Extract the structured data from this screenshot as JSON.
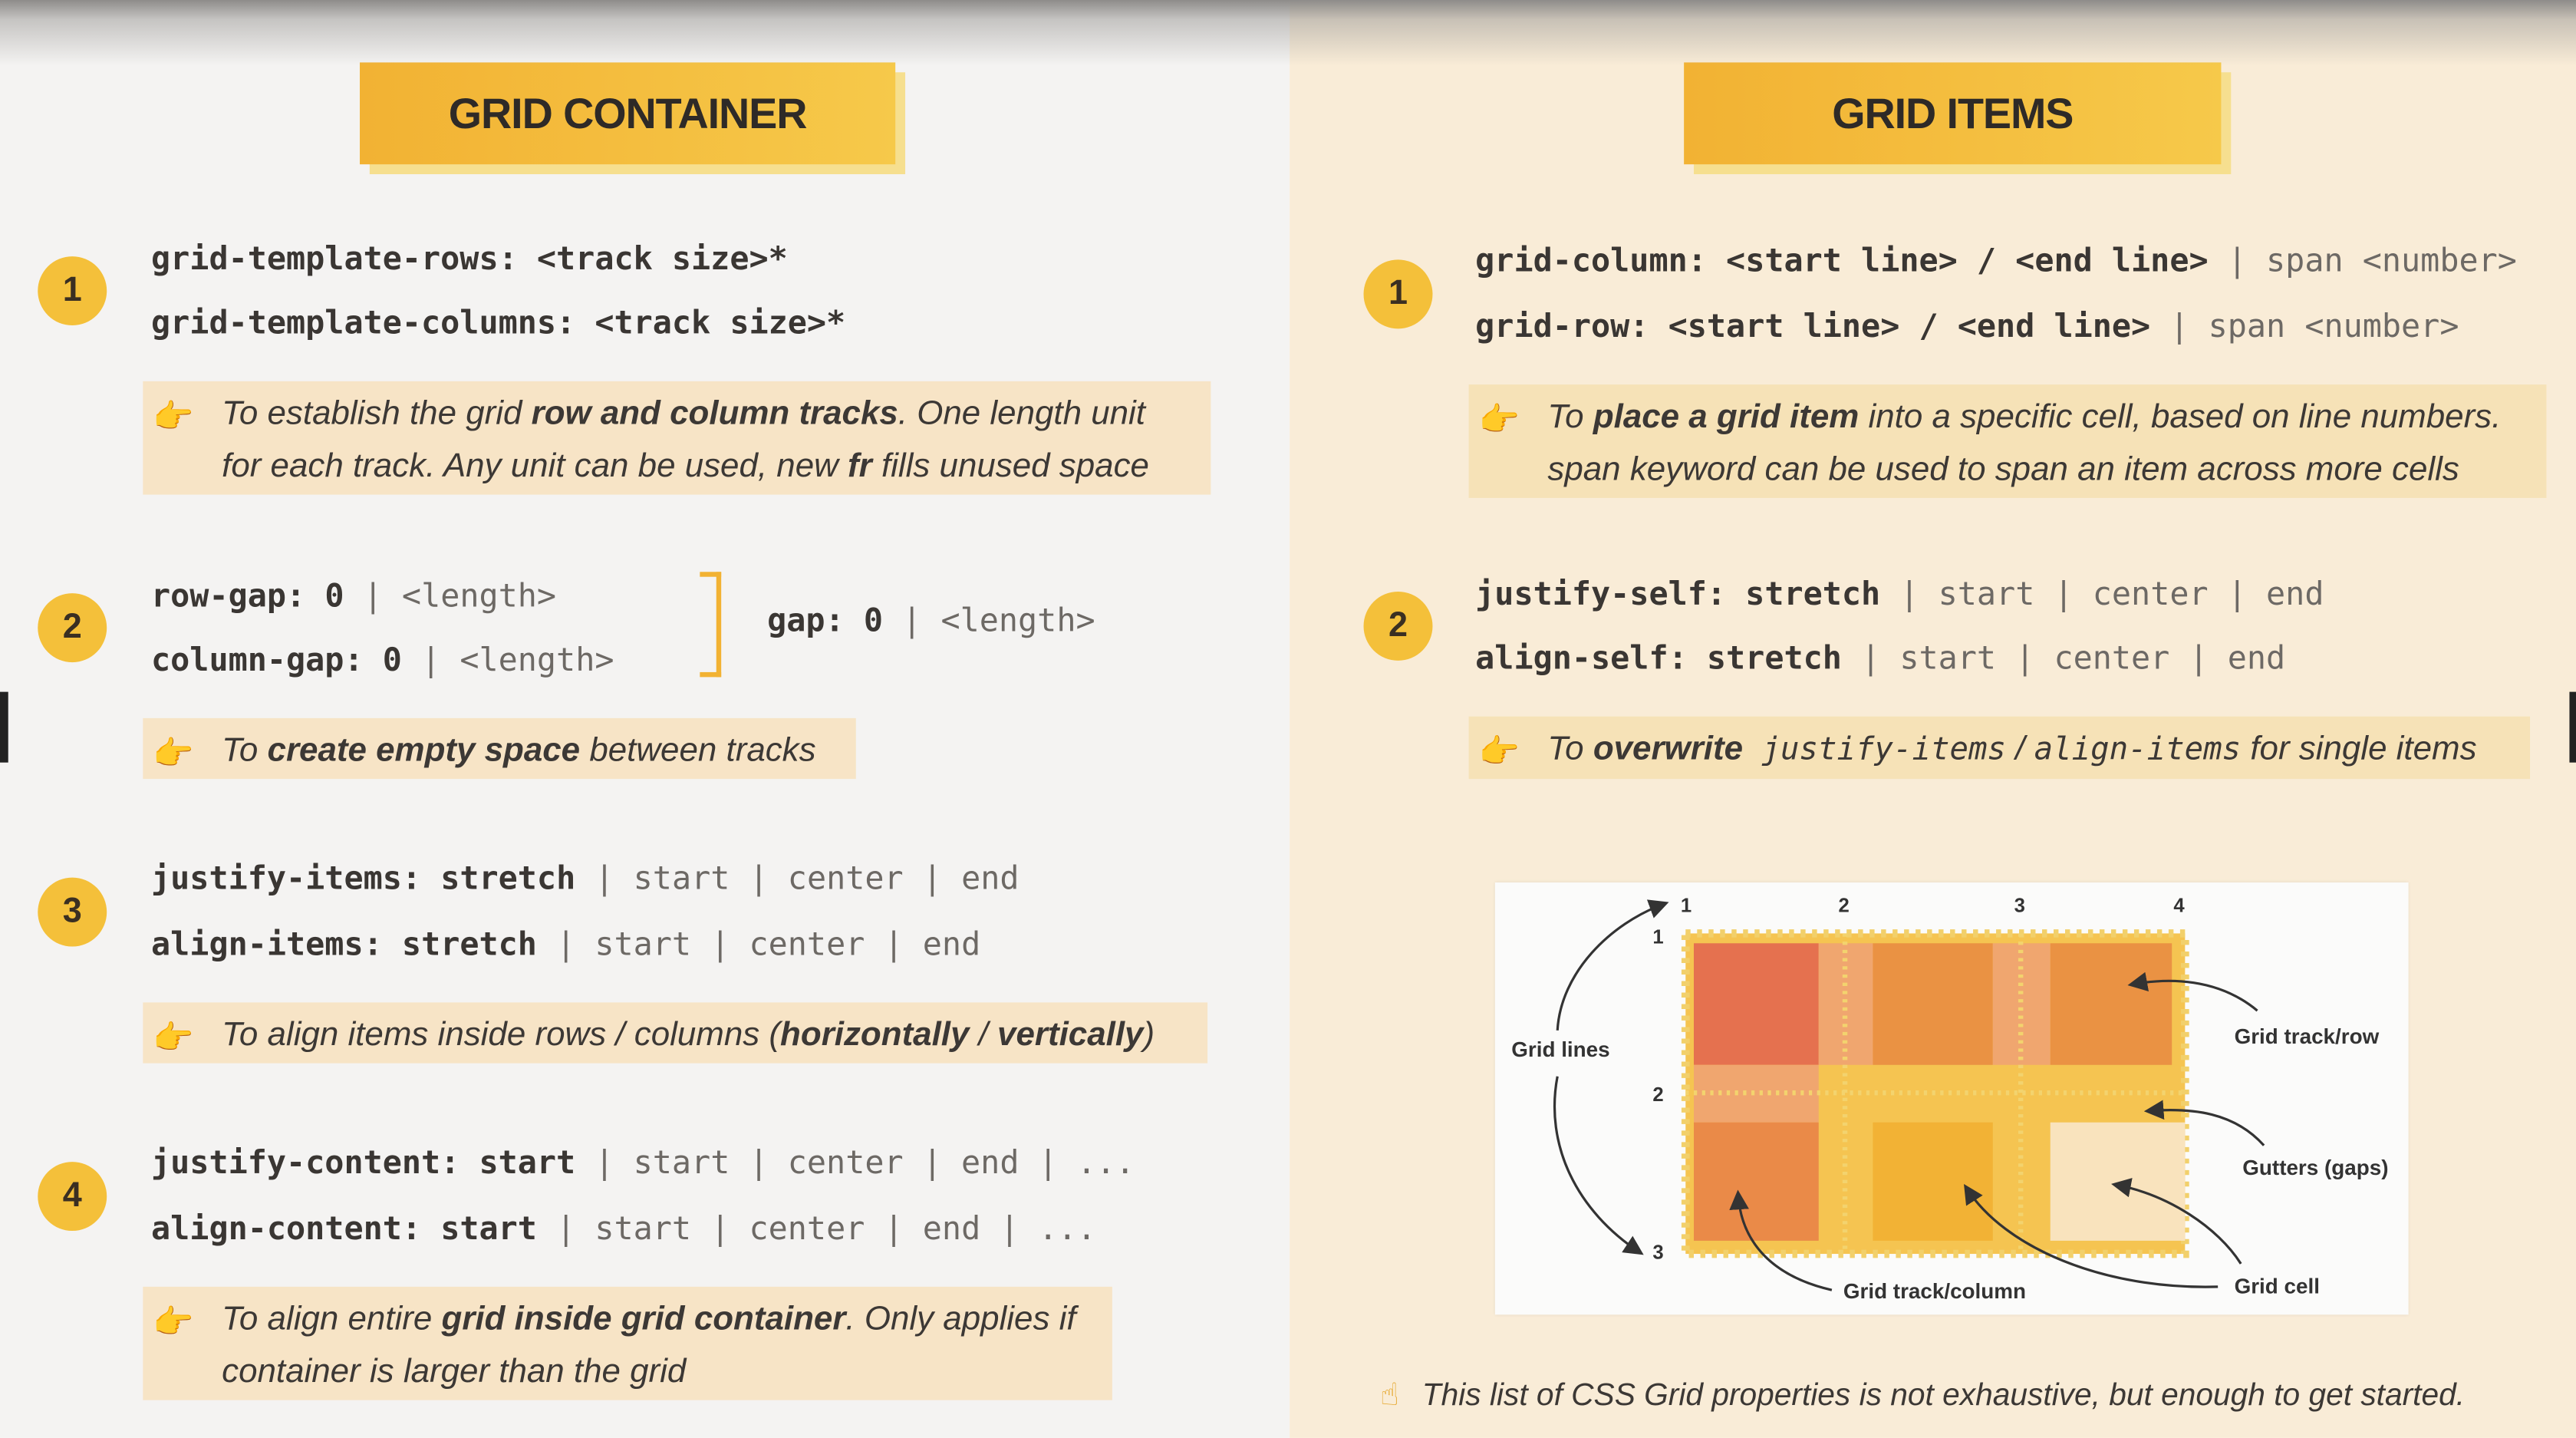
{
  "left": {
    "title": "GRID CONTAINER",
    "sections": [
      {
        "num": "1",
        "line1": {
          "prop": "grid-template-rows:",
          "val": "<track size>*"
        },
        "line2": {
          "prop": "grid-template-columns:",
          "val": "<track size>*"
        },
        "note": {
          "a": "To establish the grid ",
          "b": "row and column tracks",
          "c": ". One length unit",
          "d": "for each track. Any unit can be used, new ",
          "e": "fr",
          "f": " fills unused space"
        }
      },
      {
        "num": "2",
        "line1": {
          "prop": "row-gap:",
          "val": "0",
          "opt": " | <length>"
        },
        "line2": {
          "prop": "column-gap:",
          "val": "0",
          "opt": " | <length>"
        },
        "gap": {
          "prop": "gap:",
          "val": "0",
          "opt": " | <length>"
        },
        "note": {
          "a": "To ",
          "b": "create empty space",
          "c": " between tracks"
        }
      },
      {
        "num": "3",
        "line1": {
          "prop": "justify-items:",
          "val": "stretch",
          "opt": " | start | center | end"
        },
        "line2": {
          "prop": "align-items:",
          "val": "stretch",
          "opt": " | start | center | end"
        },
        "note": {
          "a": "To align items inside rows / columns (",
          "b": "horizontally",
          "c": " / ",
          "d": "vertically",
          "e": ")"
        }
      },
      {
        "num": "4",
        "line1": {
          "prop": "justify-content:",
          "val": "start",
          "opt": " | start | center | end | ..."
        },
        "line2": {
          "prop": "align-content:",
          "val": "start",
          "opt": " | start | center | end | ..."
        },
        "note": {
          "a": "To align entire ",
          "b": "grid inside grid container",
          "c": ". Only applies if",
          "d": "container is larger than the grid"
        }
      }
    ]
  },
  "right": {
    "title": "GRID ITEMS",
    "sections": [
      {
        "num": "1",
        "line1": {
          "prop": "grid-column:",
          "val": "<start line> / <end line>",
          "opt": " | span <number>"
        },
        "line2": {
          "prop": "grid-row:",
          "val": "<start line> / <end line>",
          "opt": " | span <number>"
        },
        "note": {
          "a": "To ",
          "b": "place a grid item",
          "c": " into a specific cell, based on line numbers.",
          "d": "span",
          "e": " keyword can be used to span an item across more cells"
        }
      },
      {
        "num": "2",
        "line1": {
          "prop": "justify-self:",
          "val": "stretch",
          "opt": " | start | center | end"
        },
        "line2": {
          "prop": "align-self:",
          "val": "stretch",
          "opt": " | start | center | end"
        },
        "note": {
          "a": "To ",
          "b": "overwrite",
          "c": " justify-items",
          "d": " / ",
          "e": "align-items",
          "f": " for single items"
        }
      }
    ],
    "diagram": {
      "col_numbers": [
        "1",
        "2",
        "3",
        "4"
      ],
      "row_numbers": [
        "1",
        "2",
        "3"
      ],
      "labels": {
        "grid_lines": "Grid lines",
        "track_row": "Grid track/row",
        "gutters": "Gutters (gaps)",
        "track_column": "Grid track/column",
        "cell": "Grid cell"
      }
    },
    "footer": "This list of CSS Grid properties is not exhaustive, but enough to get started."
  },
  "colors": {
    "accent": "#f4c03a",
    "left_bg": "#f4f3f2",
    "right_bg": "#f9ecd7",
    "note_bg": "#f7e4c6",
    "cell_red": "#e5714f",
    "cell_orange": "#ea9243",
    "cell_yellow": "#f2b235",
    "cell_light": "#f9e3bd"
  },
  "icons": {
    "note": "pointing-hand-icon",
    "footer": "pointing-up-hand-icon"
  }
}
